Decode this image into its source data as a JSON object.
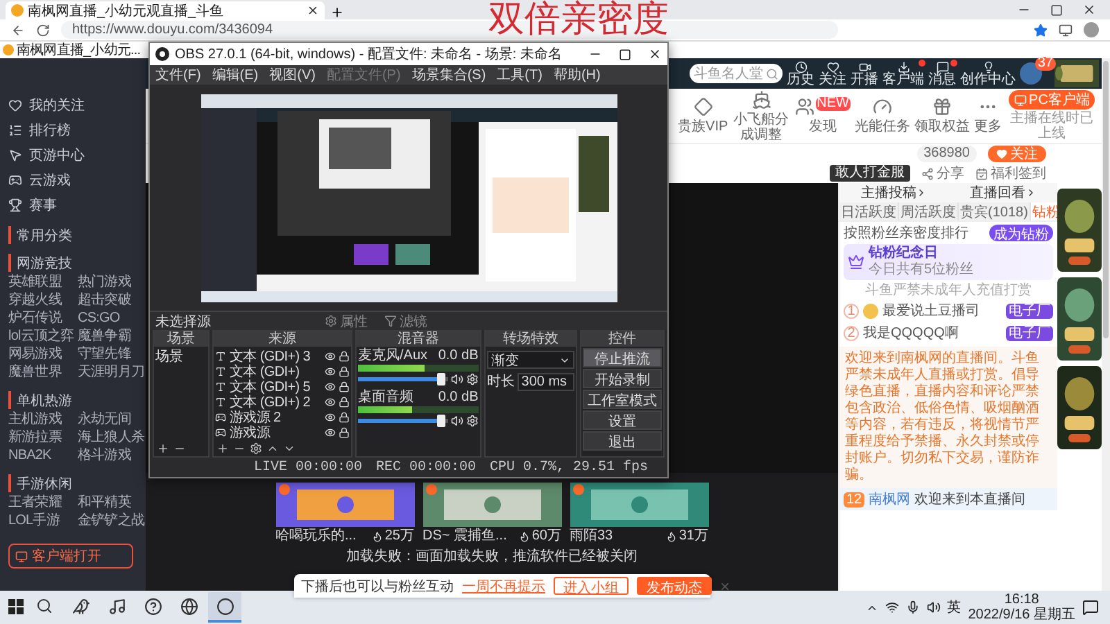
{
  "browser": {
    "tab_title": "南枫网直播_小幼元观直播_斗鱼",
    "url": "https://www.douyu.com/3436094",
    "bookmark": "南枫网直播_小幼元..."
  },
  "caption": "双倍亲密度",
  "sidebar": {
    "items": [
      {
        "label": "我的关注"
      },
      {
        "label": "排行榜"
      },
      {
        "label": "页游中心"
      },
      {
        "label": "云游戏"
      },
      {
        "label": "赛事"
      }
    ],
    "sections": [
      {
        "title": "常用分类"
      },
      {
        "title": "网游竞技",
        "links": [
          "英雄联盟",
          "热门游戏",
          "穿越火线",
          "超击突破",
          "炉石传说",
          "CS:GO",
          "lol云顶之弈",
          "魔兽争霸",
          "网易游戏",
          "守望先锋",
          "魔兽世界",
          "天涯明月刀"
        ]
      },
      {
        "title": "单机热游",
        "links": [
          "主机游戏",
          "永劫无间",
          "新游拉票",
          "海上狼人杀",
          "NBA2K",
          "格斗游戏"
        ]
      },
      {
        "title": "手游休闲",
        "links": [
          "王者荣耀",
          "和平精英",
          "LOL手游",
          "金铲铲之战"
        ]
      }
    ],
    "open_button": "客户端打开"
  },
  "header": {
    "search_placeholder": "斗鱼名人堂",
    "nav": [
      {
        "label": "历史",
        "badge": false
      },
      {
        "label": "关注",
        "badge": false
      },
      {
        "label": "开播",
        "badge": false
      },
      {
        "label": "客户端",
        "badge": true
      },
      {
        "label": "消息",
        "badge": true
      },
      {
        "label": "创作中心",
        "badge": false
      }
    ],
    "avatar_badge": "37"
  },
  "menu": {
    "items": [
      {
        "label": "贵族VIP"
      },
      {
        "label": "小飞船分成调整"
      },
      {
        "label": "发现",
        "badge": "NEW"
      },
      {
        "label": "光能任务"
      },
      {
        "label": "领取权益"
      },
      {
        "label": "更多"
      }
    ],
    "client_button": "PC客户端",
    "client_note": "主播在线时已上线"
  },
  "room": {
    "followers": "368980",
    "follow_button": "关注",
    "promo": "敢人打金服",
    "share": "分享",
    "checkin": "福利签到"
  },
  "panel": {
    "links": [
      "主播投稿",
      "直播回看"
    ],
    "tabs": [
      {
        "label": "日活跃度",
        "selected": false
      },
      {
        "label": "周活跃度",
        "selected": false
      },
      {
        "label": "贵宾(1018)",
        "selected": false
      },
      {
        "label": "钻粉",
        "selected": true
      }
    ],
    "rank_title": "按照粉丝亲密度排行",
    "join_button": "成为钻粉",
    "anniversary": {
      "title": "钻粉纪念日",
      "note": "今日共有5位粉丝"
    },
    "minor_notice": "斗鱼严禁未成年人充值打赏",
    "fans": [
      {
        "rank": "1",
        "name": "最爱说土豆播司",
        "badge": "电子厂",
        "avatar": true
      },
      {
        "rank": "2",
        "name": "我是QQQQQ啊",
        "badge": "电子厂",
        "avatar": false
      }
    ],
    "notice": "欢迎来到南枫网的直播间。斗鱼严禁未成年人直播或打赏。倡导绿色直播，直播内容和评论严禁包含政治、低俗色情、吸烟酗酒等内容，若有违反，将视情节严重程度给予禁播、永久封禁或停封账户。切勿私下交易，谨防诈骗。",
    "welcome": {
      "level": "12",
      "name": "南枫网",
      "text": "欢迎来到本直播间"
    }
  },
  "recommend": {
    "cards": [
      {
        "title": "哈喝玩乐的...",
        "heat": "25万"
      },
      {
        "title": "DS~ 震捕鱼...",
        "heat": "60万"
      },
      {
        "title": "雨陌33",
        "heat": "31万"
      }
    ],
    "message": "加载失败：画面加载失败，推流软件已经被关闭"
  },
  "notice_bar": {
    "text": "下播后也可以与粉丝互动",
    "dismiss": "一周不再提示",
    "buttons": [
      "进入小组",
      "发布动态"
    ],
    "close": "×"
  },
  "obs": {
    "title": "OBS 27.0.1 (64-bit, windows) - 配置文件: 未命名 - 场景: 未命名",
    "menu": [
      {
        "label": "文件(F)",
        "disabled": false
      },
      {
        "label": "编辑(E)",
        "disabled": false
      },
      {
        "label": "视图(V)",
        "disabled": false
      },
      {
        "label": "配置文件(P)",
        "disabled": true
      },
      {
        "label": "场景集合(S)",
        "disabled": false
      },
      {
        "label": "工具(T)",
        "disabled": false
      },
      {
        "label": "帮助(H)",
        "disabled": false
      }
    ],
    "source_label": "未选择源",
    "source_buttons": [
      "属性",
      "滤镜"
    ],
    "docks": [
      "场景",
      "来源",
      "混音器",
      "转场特效",
      "控件"
    ],
    "scenes": [
      "场景"
    ],
    "sources": [
      {
        "label": "文本 (GDI+) 3",
        "kind": "text"
      },
      {
        "label": "文本 (GDI+)",
        "kind": "text"
      },
      {
        "label": "文本 (GDI+) 5",
        "kind": "text"
      },
      {
        "label": "文本 (GDI+) 2",
        "kind": "text"
      },
      {
        "label": "游戏源 2",
        "kind": "game"
      },
      {
        "label": "游戏源",
        "kind": "game"
      }
    ],
    "mixer": [
      {
        "name": "麦克风/Aux",
        "reading": "0.0 dB",
        "meter": {
          "level": 0.55
        },
        "fader": {
          "level": 0.92
        }
      },
      {
        "name": "桌面音频",
        "reading": "0.0 dB",
        "meter": {
          "level": 0.45
        },
        "fader": {
          "level": 0.92
        }
      }
    ],
    "transition": {
      "type": "渐变",
      "duration_label": "时长",
      "duration": "300 ms"
    },
    "controls": [
      {
        "label": "停止推流",
        "active": true
      },
      {
        "label": "开始录制",
        "active": false
      },
      {
        "label": "工作室模式",
        "active": false
      },
      {
        "label": "设置",
        "active": false
      },
      {
        "label": "退出",
        "active": false
      }
    ],
    "live": "LIVE 00:00:00",
    "rec": "REC 00:00:00",
    "stats": "CPU 0.7%, 29.51 fps"
  },
  "taskbar": {
    "apps": [
      {
        "selected": false
      },
      {
        "selected": false
      },
      {
        "selected": false
      },
      {
        "selected": false
      },
      {
        "selected": true
      }
    ],
    "ime": "英",
    "time": "16:18",
    "date": "2022/9/16 星期五"
  }
}
